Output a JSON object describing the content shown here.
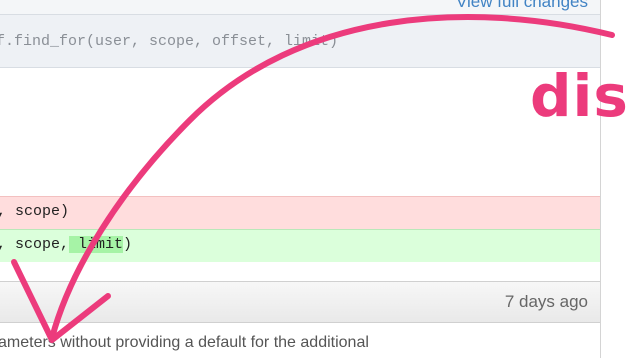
{
  "header": {
    "view_changes_label": "View full changes",
    "code_line": "f.find_for(user, scope, offset, limit)"
  },
  "diff": {
    "removed_line": ", scope)",
    "added_prefix": ", scope,",
    "added_highlight": " limit",
    "added_suffix": ")"
  },
  "commit": {
    "time_ago": "7 days ago",
    "message": "ameters without providing a default for the additional"
  },
  "annotation": {
    "word": "dis",
    "color": "#ec3b7c",
    "icon": "curved-arrow-icon"
  }
}
